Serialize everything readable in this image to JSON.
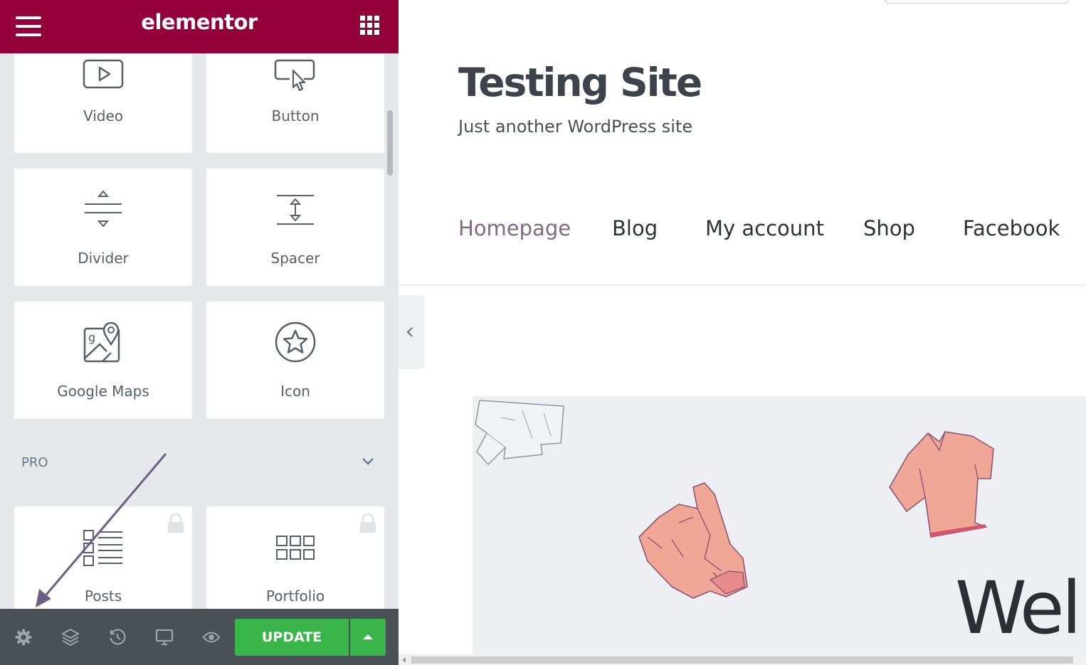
{
  "editor": {
    "brand": "elementor",
    "widgets": [
      {
        "label": "Video",
        "icon": "video-icon"
      },
      {
        "label": "Button",
        "icon": "button-click-icon"
      },
      {
        "label": "Divider",
        "icon": "divider-icon"
      },
      {
        "label": "Spacer",
        "icon": "spacer-icon"
      },
      {
        "label": "Google Maps",
        "icon": "map-pin-icon"
      },
      {
        "label": "Icon",
        "icon": "star-icon"
      }
    ],
    "pro_section": {
      "title": "PRO",
      "widgets": [
        {
          "label": "Posts",
          "icon": "posts-list-icon",
          "locked": true
        },
        {
          "label": "Portfolio",
          "icon": "portfolio-grid-icon",
          "locked": true
        }
      ]
    },
    "footer": {
      "tools": [
        "settings-icon",
        "navigator-layers-icon",
        "history-icon",
        "responsive-desktop-icon",
        "preview-eye-icon"
      ],
      "update_label": "UPDATE"
    },
    "colors": {
      "brand": "#93003a",
      "update": "#39b54a",
      "footer": "#495157",
      "panel": "#e6e9ec"
    }
  },
  "preview": {
    "site_title": "Testing Site",
    "tagline": "Just another WordPress site",
    "nav": [
      {
        "label": "Homepage",
        "active": true
      },
      {
        "label": "Blog",
        "active": false
      },
      {
        "label": "My account",
        "active": false
      },
      {
        "label": "Shop",
        "active": false
      },
      {
        "label": "Facebook",
        "active": false
      }
    ],
    "hero_text": "Wel",
    "colors": {
      "active_nav": "#826886",
      "title": "#3c434a"
    }
  }
}
